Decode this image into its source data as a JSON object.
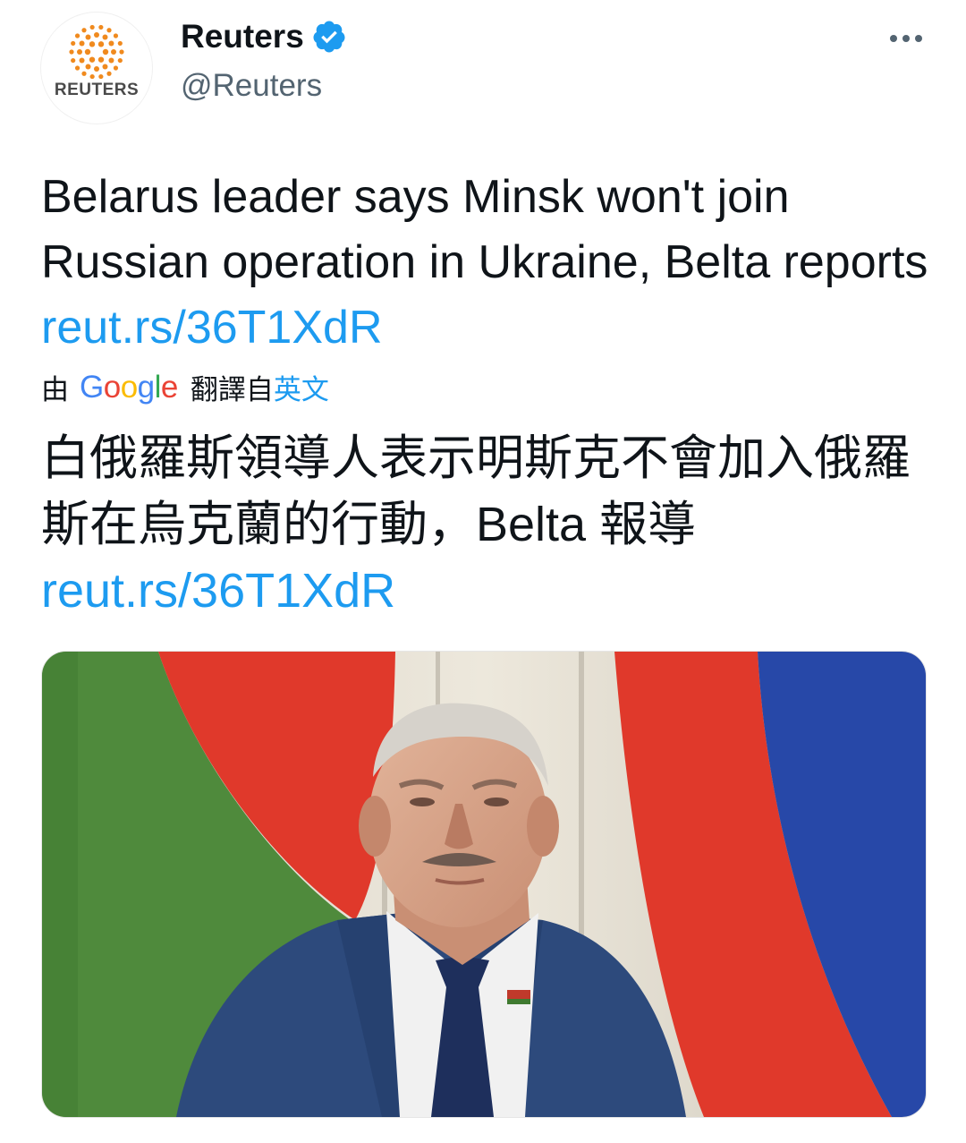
{
  "header": {
    "avatar_word": "REUTERS",
    "display_name": "Reuters",
    "handle": "@Reuters",
    "verified_icon": "verified-badge-icon",
    "more_icon": "more-options-icon"
  },
  "tweet": {
    "text": "Belarus leader says Minsk won't join Russian operation in Ukraine, Belta reports ",
    "link": "reut.rs/36T1XdR"
  },
  "translation": {
    "prefix": "由",
    "google_word": "Google",
    "suffix": "翻譯自",
    "language": "英文",
    "text": "白俄羅斯領導人表示明斯克不會加入俄羅斯在烏克蘭的行動，Belta 報導",
    "link": "reut.rs/36T1XdR"
  },
  "colors": {
    "link": "#1d9bf0",
    "text": "#0f1419",
    "secondary": "#536471",
    "reuters_orange": "#f08a1e"
  }
}
